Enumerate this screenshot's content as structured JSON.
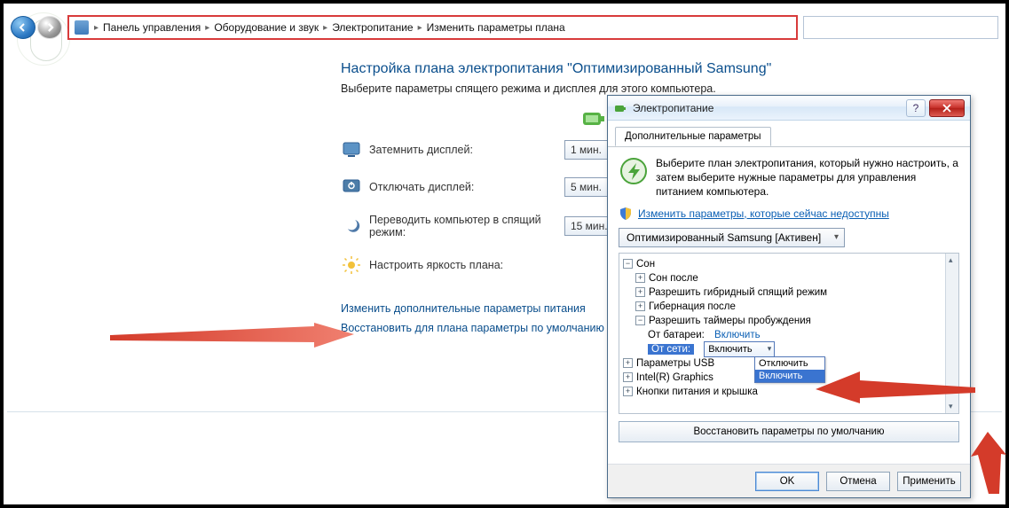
{
  "breadcrumb": {
    "items": [
      "Панель управления",
      "Оборудование и звук",
      "Электропитание",
      "Изменить параметры плана"
    ]
  },
  "page": {
    "title": "Настройка плана электропитания \"Оптимизированный Samsung\"",
    "subtitle": "Выберите параметры спящего режима и дисплея для этого компьютера.",
    "rows": {
      "dim": {
        "label": "Затемнить дисплей:",
        "value": "1 мин."
      },
      "off": {
        "label": "Отключать дисплей:",
        "value": "5 мин."
      },
      "sleep": {
        "label": "Переводить компьютер в спящий режим:",
        "value": "15 мин."
      },
      "bright": {
        "label": "Настроить яркость плана:"
      }
    },
    "links": {
      "advanced": "Изменить дополнительные параметры питания",
      "restore": "Восстановить для плана параметры по умолчанию"
    }
  },
  "dialog": {
    "title": "Электропитание",
    "tab": "Дополнительные параметры",
    "desc": "Выберите план электропитания, который нужно настроить, а затем выберите нужные параметры для управления питанием компьютера.",
    "unavailable_link": "Изменить параметры, которые сейчас недоступны",
    "plan_combo": "Оптимизированный Samsung [Активен]",
    "tree": {
      "sleep": "Сон",
      "sleep_after": "Сон после",
      "hybrid": "Разрешить гибридный спящий режим",
      "hibernate": "Гибернация после",
      "wake_timers": "Разрешить таймеры пробуждения",
      "on_battery_label": "От батареи:",
      "on_battery_value": "Включить",
      "on_ac_label": "От сети:",
      "on_ac_value": "Включить",
      "usb": "Параметры USB",
      "intel": "Intel(R) Graphics",
      "buttons": "Кнопки питания и крышка",
      "dropdown_off": "Отключить",
      "dropdown_on": "Включить"
    },
    "restore_btn": "Восстановить параметры по умолчанию",
    "ok": "OK",
    "cancel": "Отмена",
    "apply": "Применить"
  }
}
